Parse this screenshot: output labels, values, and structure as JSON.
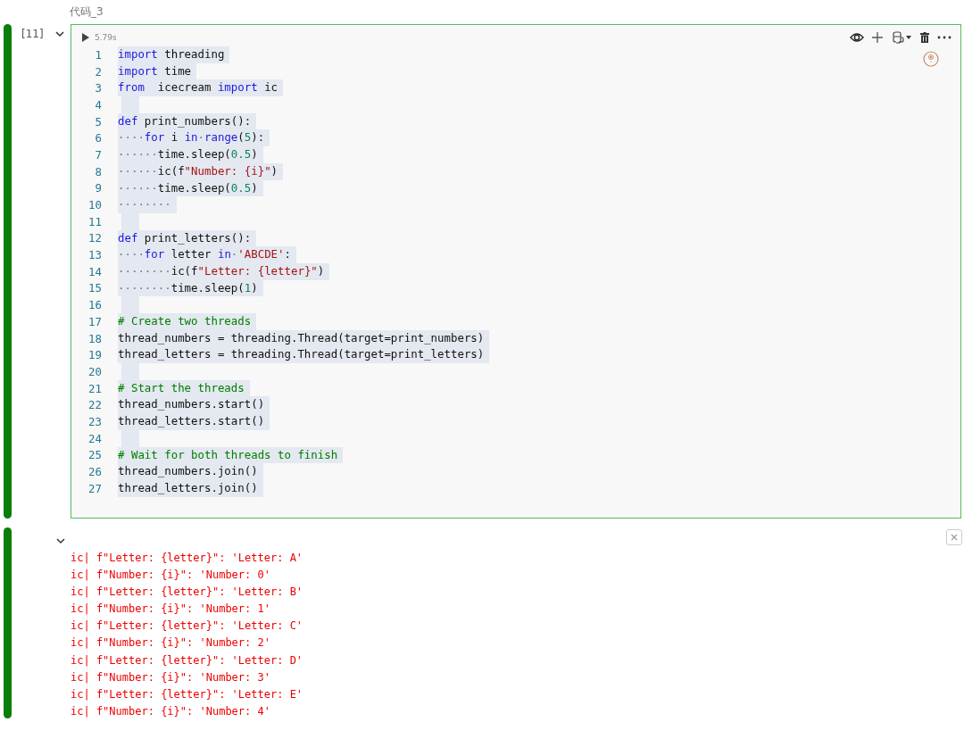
{
  "cell_title": "代码_3",
  "code_cell": {
    "execution_count": "[11]",
    "expanded": true,
    "run_time": "5.79s",
    "lines": [
      {
        "number": "1",
        "tokens": [
          {
            "kind": "kw",
            "text": "import"
          },
          {
            "kind": "plain",
            "text": " threading"
          }
        ]
      },
      {
        "number": "2",
        "tokens": [
          {
            "kind": "kw",
            "text": "import"
          },
          {
            "kind": "plain",
            "text": " time"
          }
        ]
      },
      {
        "number": "3",
        "tokens": [
          {
            "kind": "kw",
            "text": "from"
          },
          {
            "kind": "plain",
            "text": "  icecream "
          },
          {
            "kind": "kw",
            "text": "import"
          },
          {
            "kind": "plain",
            "text": " ic"
          }
        ]
      },
      {
        "number": "4"
      },
      {
        "number": "5",
        "tokens": [
          {
            "kind": "kw",
            "text": "def"
          },
          {
            "kind": "plain",
            "text": " print_numbers():"
          }
        ]
      },
      {
        "number": "6",
        "tokens": [
          {
            "kind": "ws",
            "text": "····"
          },
          {
            "kind": "kw",
            "text": "for"
          },
          {
            "kind": "plain",
            "text": " i "
          },
          {
            "kind": "kw",
            "text": "in"
          },
          {
            "kind": "ws",
            "text": "·"
          },
          {
            "kind": "kw",
            "text": "range"
          },
          {
            "kind": "plain",
            "text": "("
          },
          {
            "kind": "num",
            "text": "5"
          },
          {
            "kind": "plain",
            "text": "):"
          }
        ]
      },
      {
        "number": "7",
        "tokens": [
          {
            "kind": "ws",
            "text": "······"
          },
          {
            "kind": "plain",
            "text": "time.sleep("
          },
          {
            "kind": "num",
            "text": "0.5"
          },
          {
            "kind": "plain",
            "text": ")"
          }
        ]
      },
      {
        "number": "8",
        "tokens": [
          {
            "kind": "ws",
            "text": "······"
          },
          {
            "kind": "plain",
            "text": "ic(f"
          },
          {
            "kind": "str",
            "text": "\"Number: {i}\""
          },
          {
            "kind": "plain",
            "text": ")"
          }
        ]
      },
      {
        "number": "9",
        "tokens": [
          {
            "kind": "ws",
            "text": "······"
          },
          {
            "kind": "plain",
            "text": "time.sleep("
          },
          {
            "kind": "num",
            "text": "0.5"
          },
          {
            "kind": "plain",
            "text": ")"
          }
        ]
      },
      {
        "number": "10",
        "tokens": [
          {
            "kind": "ws",
            "text": "········"
          }
        ]
      },
      {
        "number": "11"
      },
      {
        "number": "12",
        "tokens": [
          {
            "kind": "kw",
            "text": "def"
          },
          {
            "kind": "plain",
            "text": " print_letters():"
          }
        ]
      },
      {
        "number": "13",
        "tokens": [
          {
            "kind": "ws",
            "text": "····"
          },
          {
            "kind": "kw",
            "text": "for"
          },
          {
            "kind": "plain",
            "text": " letter "
          },
          {
            "kind": "kw",
            "text": "in"
          },
          {
            "kind": "ws",
            "text": "·"
          },
          {
            "kind": "str",
            "text": "'ABCDE'"
          },
          {
            "kind": "plain",
            "text": ":"
          }
        ]
      },
      {
        "number": "14",
        "tokens": [
          {
            "kind": "ws",
            "text": "········"
          },
          {
            "kind": "plain",
            "text": "ic(f"
          },
          {
            "kind": "str",
            "text": "\"Letter: {letter}\""
          },
          {
            "kind": "plain",
            "text": ")"
          }
        ]
      },
      {
        "number": "15",
        "tokens": [
          {
            "kind": "ws",
            "text": "········"
          },
          {
            "kind": "plain",
            "text": "time.sleep("
          },
          {
            "kind": "num",
            "text": "1"
          },
          {
            "kind": "plain",
            "text": ")"
          }
        ]
      },
      {
        "number": "16"
      },
      {
        "number": "17",
        "tokens": [
          {
            "kind": "com",
            "text": "# Create two threads"
          }
        ]
      },
      {
        "number": "18",
        "tokens": [
          {
            "kind": "plain",
            "text": "thread_numbers = threading.Thread(target=print_numbers)"
          }
        ]
      },
      {
        "number": "19",
        "tokens": [
          {
            "kind": "plain",
            "text": "thread_letters = threading.Thread(target=print_letters)"
          }
        ]
      },
      {
        "number": "20"
      },
      {
        "number": "21",
        "tokens": [
          {
            "kind": "com",
            "text": "# Start the threads"
          }
        ]
      },
      {
        "number": "22",
        "tokens": [
          {
            "kind": "plain",
            "text": "thread_numbers.start()"
          }
        ]
      },
      {
        "number": "23",
        "tokens": [
          {
            "kind": "plain",
            "text": "thread_letters.start()"
          }
        ]
      },
      {
        "number": "24"
      },
      {
        "number": "25",
        "tokens": [
          {
            "kind": "com",
            "text": "# Wait for both threads to finish"
          }
        ]
      },
      {
        "number": "26",
        "tokens": [
          {
            "kind": "plain",
            "text": "thread_numbers.join()"
          }
        ]
      },
      {
        "number": "27",
        "tokens": [
          {
            "kind": "plain",
            "text": "thread_letters.join()"
          }
        ]
      }
    ]
  },
  "output_cell": {
    "expanded": true,
    "lines": [
      "ic| f\"Letter: {letter}\": 'Letter: A'",
      "ic| f\"Number: {i}\": 'Number: 0'",
      "ic| f\"Letter: {letter}\": 'Letter: B'",
      "ic| f\"Number: {i}\": 'Number: 1'",
      "ic| f\"Letter: {letter}\": 'Letter: C'",
      "ic| f\"Number: {i}\": 'Number: 2'",
      "ic| f\"Letter: {letter}\": 'Letter: D'",
      "ic| f\"Number: {i}\": 'Number: 3'",
      "ic| f\"Letter: {letter}\": 'Letter: E'",
      "ic| f\"Number: {i}\": 'Number: 4'"
    ]
  }
}
